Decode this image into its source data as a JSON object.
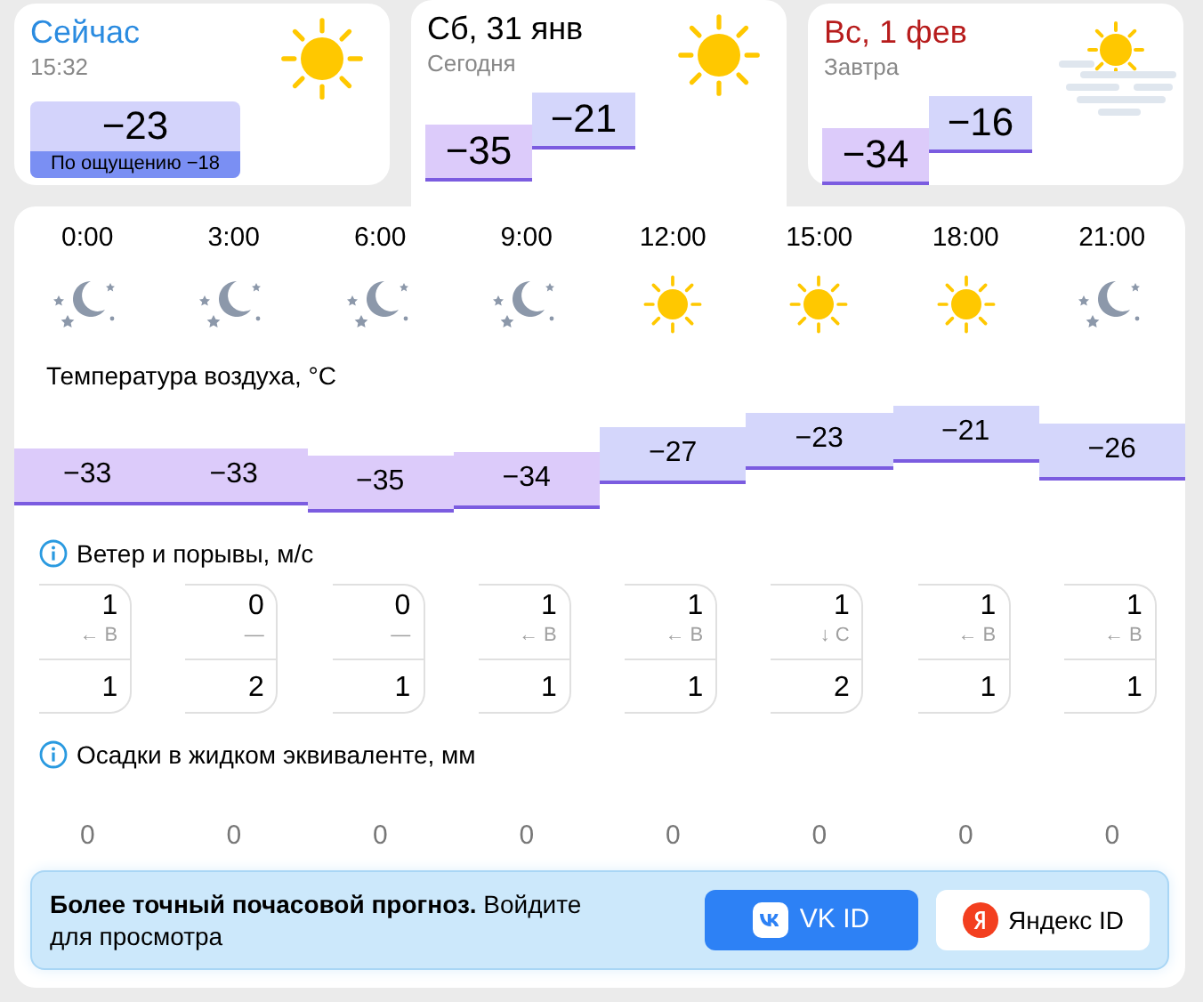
{
  "cards": [
    {
      "kind": "now",
      "title": "Сейчас",
      "color": "#2a8be0",
      "subtitle": "15:32",
      "temp": "−23",
      "feels": "По ощущению −18",
      "fog": false,
      "selected": false
    },
    {
      "kind": "day",
      "title": "Сб, 31 янв",
      "color": "#000000",
      "subtitle": "Сегодня",
      "night_temp": "−35",
      "day_temp": "−21",
      "fog": false,
      "selected": true
    },
    {
      "kind": "day",
      "title": "Вс, 1 фев",
      "color": "#b71c1c",
      "subtitle": "Завтра",
      "night_temp": "−34",
      "day_temp": "−16",
      "fog": true,
      "selected": false
    }
  ],
  "hourly": {
    "hours": [
      {
        "time": "0:00",
        "kind": "night",
        "temp": "−33"
      },
      {
        "time": "3:00",
        "kind": "night",
        "temp": "−33"
      },
      {
        "time": "6:00",
        "kind": "night",
        "temp": "−35"
      },
      {
        "time": "9:00",
        "kind": "night",
        "temp": "−34"
      },
      {
        "time": "12:00",
        "kind": "sun",
        "temp": "−27"
      },
      {
        "time": "15:00",
        "kind": "sun",
        "temp": "−23"
      },
      {
        "time": "18:00",
        "kind": "sun",
        "temp": "−21"
      },
      {
        "time": "21:00",
        "kind": "night",
        "temp": "−26"
      }
    ],
    "temperature_title": "Температура воздуха, °C",
    "wind_title": "Ветер и порывы, м/с",
    "wind": [
      {
        "speed": "1",
        "direction": "← В",
        "gust": "1"
      },
      {
        "speed": "0",
        "direction": "—",
        "gust": "2"
      },
      {
        "speed": "0",
        "direction": "—",
        "gust": "1"
      },
      {
        "speed": "1",
        "direction": "← В",
        "gust": "1"
      },
      {
        "speed": "1",
        "direction": "← В",
        "gust": "1"
      },
      {
        "speed": "1",
        "direction": "↓ С",
        "gust": "2"
      },
      {
        "speed": "1",
        "direction": "← В",
        "gust": "1"
      },
      {
        "speed": "1",
        "direction": "← В",
        "gust": "1"
      }
    ],
    "precip_title": "Осадки в жидком эквиваленте, мм",
    "precip": [
      "0",
      "0",
      "0",
      "0",
      "0",
      "0",
      "0",
      "0"
    ]
  },
  "banner": {
    "text": "**Более точный почасовой прогноз.** Войдите для просмотра",
    "buttons": [
      {
        "kind": "vk",
        "label": "VK ID"
      },
      {
        "kind": "yandex",
        "label": "Яндекс ID"
      }
    ]
  }
}
